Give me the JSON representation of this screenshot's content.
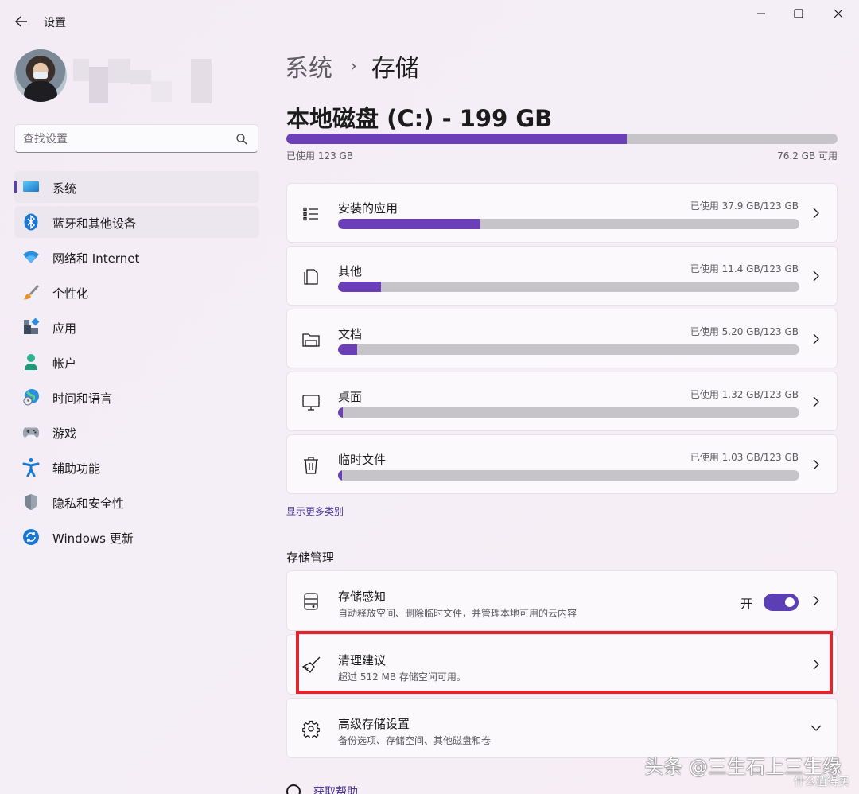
{
  "window": {
    "title": "设置",
    "controls": [
      "minimize",
      "maximize",
      "close"
    ]
  },
  "search": {
    "placeholder": "查找设置",
    "value": ""
  },
  "sidebar": {
    "items": [
      {
        "label": "系统",
        "icon": "monitor-icon",
        "active": true
      },
      {
        "label": "蓝牙和其他设备",
        "icon": "bluetooth-icon"
      },
      {
        "label": "网络和 Internet",
        "icon": "wifi-icon"
      },
      {
        "label": "个性化",
        "icon": "brush-icon"
      },
      {
        "label": "应用",
        "icon": "apps-icon"
      },
      {
        "label": "帐户",
        "icon": "person-icon"
      },
      {
        "label": "时间和语言",
        "icon": "globe-clock-icon"
      },
      {
        "label": "游戏",
        "icon": "gamepad-icon"
      },
      {
        "label": "辅助功能",
        "icon": "accessibility-icon"
      },
      {
        "label": "隐私和安全性",
        "icon": "shield-icon"
      },
      {
        "label": "Windows 更新",
        "icon": "update-icon"
      }
    ]
  },
  "breadcrumb": {
    "parent": "系统",
    "separator": "›",
    "current": "存储"
  },
  "disk": {
    "title": "本地磁盘 (C:) - 199 GB",
    "used_label": "已使用 123 GB",
    "free_label": "76.2 GB 可用",
    "used_fraction": 0.618
  },
  "categories": [
    {
      "name": "安装的应用",
      "usage": "已使用 37.9 GB/123 GB",
      "fraction": 0.308,
      "icon": "list-icon"
    },
    {
      "name": "其他",
      "usage": "已使用 11.4 GB/123 GB",
      "fraction": 0.093,
      "icon": "document-other-icon"
    },
    {
      "name": "文档",
      "usage": "已使用 5.20 GB/123 GB",
      "fraction": 0.042,
      "icon": "folder-icon"
    },
    {
      "name": "桌面",
      "usage": "已使用 1.32 GB/123 GB",
      "fraction": 0.011,
      "icon": "desktop-icon"
    },
    {
      "name": "临时文件",
      "usage": "已使用 1.03 GB/123 GB",
      "fraction": 0.008,
      "icon": "trash-icon"
    }
  ],
  "show_more": "显示更多类别",
  "management": {
    "title": "存储管理",
    "items": [
      {
        "name": "存储感知",
        "desc": "自动释放空间、删除临时文件，并管理本地可用的云内容",
        "toggle_label": "开",
        "toggle_on": true,
        "icon": "storage-sense-icon"
      },
      {
        "name": "清理建议",
        "desc": "超过 512 MB 存储空间可用。",
        "icon": "broom-icon"
      },
      {
        "name": "高级存储设置",
        "desc": "备份选项、存储空间、其他磁盘和卷",
        "icon": "gear-icon"
      }
    ]
  },
  "help": {
    "label": "获取帮助"
  },
  "watermark": {
    "main": "头条 @三生石上三生缘",
    "sub": "什么值得买"
  },
  "colors": {
    "accent": "#6a3fb7",
    "highlight": "#e0262c",
    "bar_bg": "#c7c4c9"
  }
}
